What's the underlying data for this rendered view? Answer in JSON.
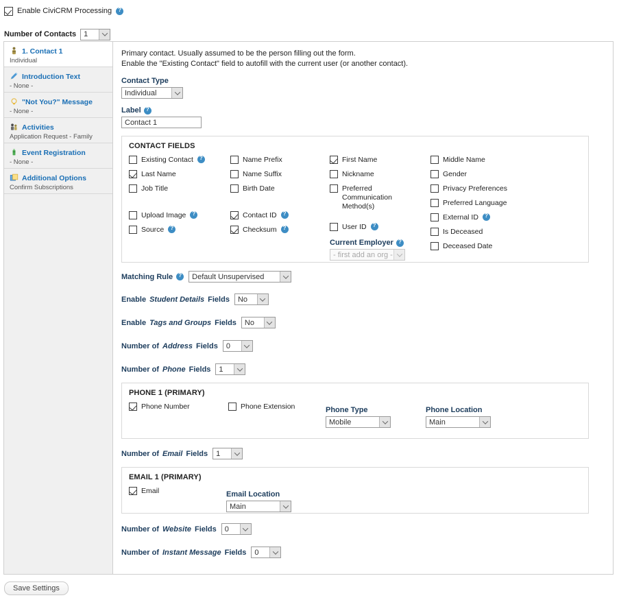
{
  "top": {
    "enable_processing_label": "Enable CiviCRM Processing",
    "enable_processing_checked": true,
    "number_of_contacts_label": "Number of Contacts",
    "number_of_contacts_value": "1"
  },
  "sidebar": {
    "items": [
      {
        "title": "1. Contact 1",
        "subtitle": "Individual",
        "icon": "person-icon",
        "active": true
      },
      {
        "title": "Introduction Text",
        "subtitle": "- None -",
        "icon": "pencil-icon",
        "active": false
      },
      {
        "title": "\"Not You?\" Message",
        "subtitle": "- None -",
        "icon": "lightbulb-icon",
        "active": false
      },
      {
        "title": "Activities",
        "subtitle": "Application Request - Family",
        "icon": "people-icon",
        "active": false
      },
      {
        "title": "Event Registration",
        "subtitle": "- None -",
        "icon": "ticket-icon",
        "active": false
      },
      {
        "title": "Additional Options",
        "subtitle": "Confirm Subscriptions",
        "icon": "options-icon",
        "active": false
      }
    ]
  },
  "main": {
    "description_line1": "Primary contact. Usually assumed to be the person filling out the form.",
    "description_line2": "Enable the \"Existing Contact\" field to autofill with the current user (or another contact).",
    "contact_type_label": "Contact Type",
    "contact_type_value": "Individual",
    "label_label": "Label",
    "label_value": "Contact 1",
    "contact_fields_title": "CONTACT FIELDS",
    "contact_fields": {
      "col1": [
        {
          "label": "Existing Contact",
          "checked": false,
          "help": true
        },
        {
          "label": "Last Name",
          "checked": true,
          "help": false
        },
        {
          "label": "Job Title",
          "checked": false,
          "help": false
        },
        {
          "label": "Upload Image",
          "checked": false,
          "help": true
        },
        {
          "label": "Source",
          "checked": false,
          "help": true
        }
      ],
      "col2": [
        {
          "label": "Name Prefix",
          "checked": false,
          "help": false
        },
        {
          "label": "Name Suffix",
          "checked": false,
          "help": false
        },
        {
          "label": "Birth Date",
          "checked": false,
          "help": false
        },
        {
          "label": "Contact ID",
          "checked": true,
          "help": true
        },
        {
          "label": "Checksum",
          "checked": true,
          "help": true
        }
      ],
      "col3": [
        {
          "label": "First Name",
          "checked": true,
          "help": false
        },
        {
          "label": "Nickname",
          "checked": false,
          "help": false
        },
        {
          "label": "Preferred Communication Method(s)",
          "checked": false,
          "help": false
        },
        {
          "label": "User ID",
          "checked": false,
          "help": true
        }
      ],
      "col4": [
        {
          "label": "Middle Name",
          "checked": false,
          "help": false
        },
        {
          "label": "Gender",
          "checked": false,
          "help": false
        },
        {
          "label": "Privacy Preferences",
          "checked": false,
          "help": false
        },
        {
          "label": "Preferred Language",
          "checked": false,
          "help": false
        },
        {
          "label": "External ID",
          "checked": false,
          "help": true
        },
        {
          "label": "Is Deceased",
          "checked": false,
          "help": false
        },
        {
          "label": "Deceased Date",
          "checked": false,
          "help": false
        }
      ],
      "current_employer_label": "Current Employer",
      "current_employer_value": "- first add an org -"
    },
    "matching_rule_label": "Matching Rule",
    "matching_rule_value": "Default Unsupervised",
    "student_details_prefix": "Enable",
    "student_details_italic": "Student Details",
    "student_details_suffix": "Fields",
    "student_details_value": "No",
    "tags_groups_prefix": "Enable",
    "tags_groups_italic": "Tags and Groups",
    "tags_groups_suffix": "Fields",
    "tags_groups_value": "No",
    "address_prefix": "Number of",
    "address_italic": "Address",
    "address_suffix": "Fields",
    "address_value": "0",
    "phone_prefix": "Number of",
    "phone_italic": "Phone",
    "phone_suffix": "Fields",
    "phone_value": "1",
    "phone_box": {
      "title": "PHONE 1 (PRIMARY)",
      "phone_number_label": "Phone Number",
      "phone_number_checked": true,
      "phone_extension_label": "Phone Extension",
      "phone_extension_checked": false,
      "phone_type_label": "Phone Type",
      "phone_type_value": "Mobile",
      "phone_location_label": "Phone Location",
      "phone_location_value": "Main"
    },
    "email_prefix": "Number of",
    "email_italic": "Email",
    "email_suffix": "Fields",
    "email_value": "1",
    "email_box": {
      "title": "EMAIL 1 (PRIMARY)",
      "email_label": "Email",
      "email_checked": true,
      "email_location_label": "Email Location",
      "email_location_value": "Main"
    },
    "website_prefix": "Number of",
    "website_italic": "Website",
    "website_suffix": "Fields",
    "website_value": "0",
    "im_prefix": "Number of",
    "im_italic": "Instant Message",
    "im_suffix": "Fields",
    "im_value": "0"
  },
  "footer": {
    "save_label": "Save Settings"
  },
  "colors": {
    "link": "#1a6fb5",
    "label": "#1c3c5c",
    "help": "#3d8dc4",
    "panel_border": "#cfcfcf",
    "sidebar_bg": "#f0f0f0"
  }
}
